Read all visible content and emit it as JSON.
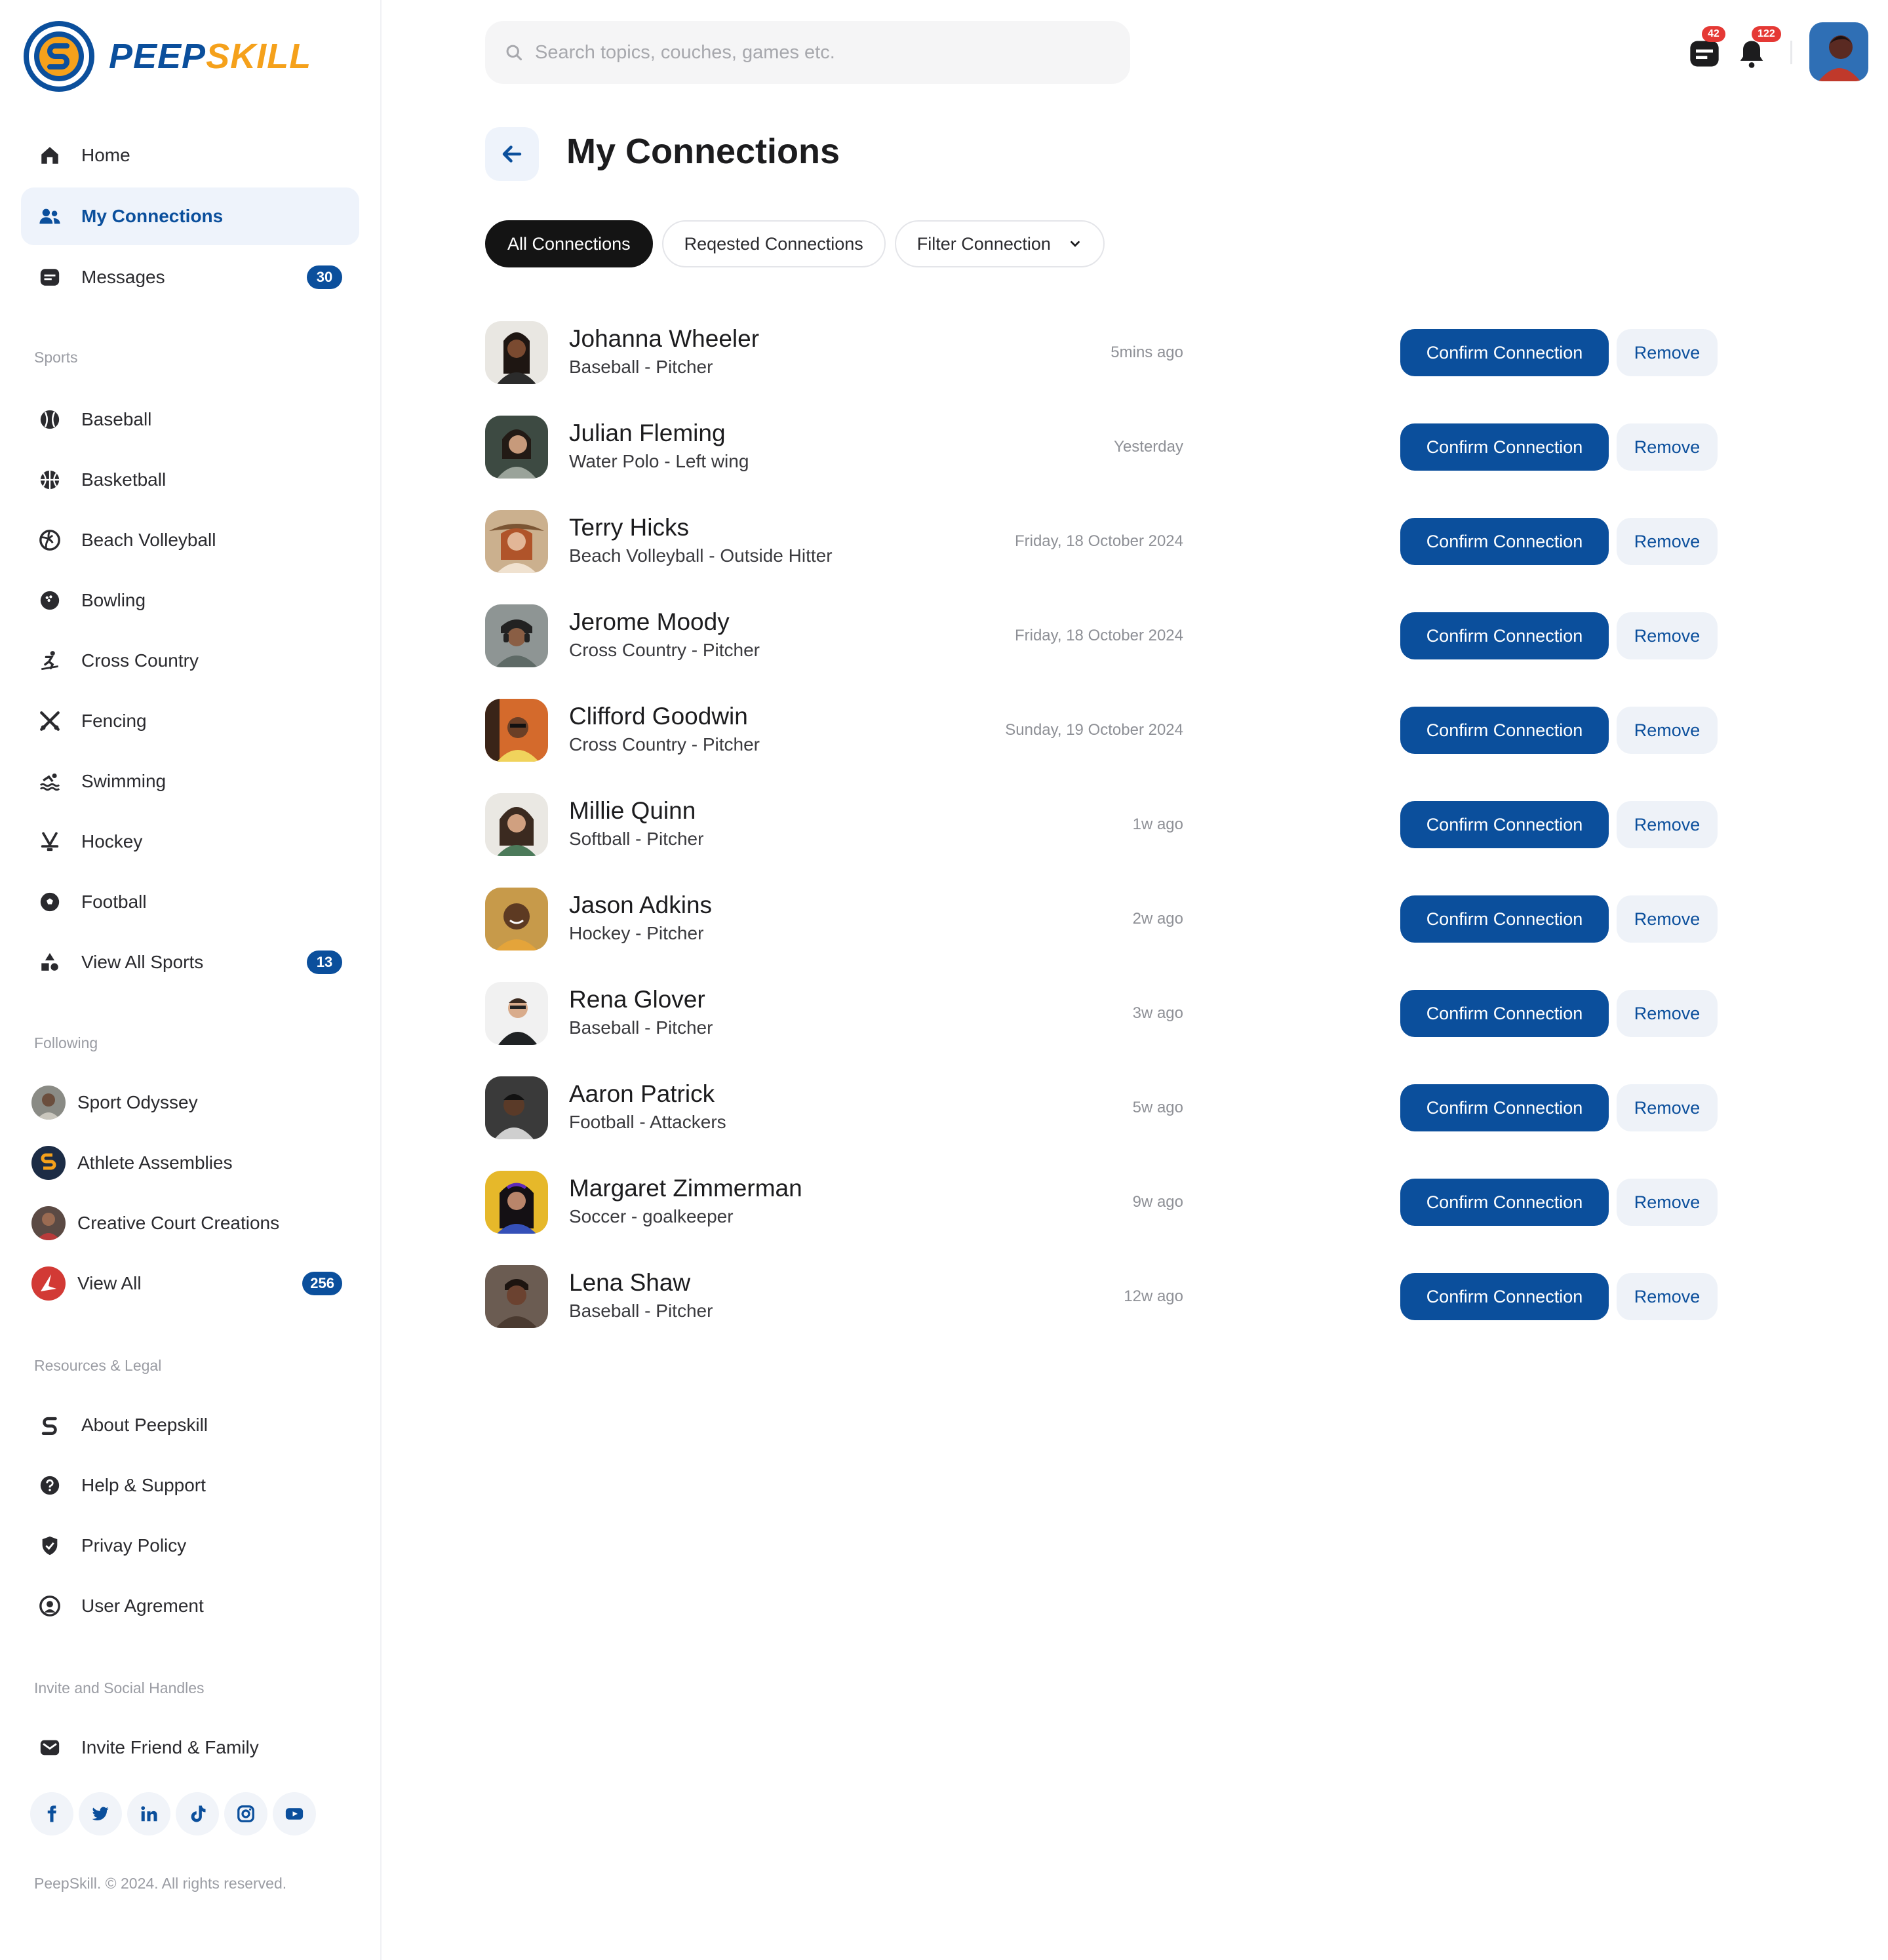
{
  "brand": {
    "name_part1": "PEEP",
    "name_part2": "SKILL",
    "primary_color": "#0b4f9c",
    "accent_color": "#f5a11b"
  },
  "nav": {
    "main": [
      {
        "label": "Home",
        "icon": "home-icon"
      },
      {
        "label": "My Connections",
        "icon": "connections-icon",
        "active": true
      },
      {
        "label": "Messages",
        "icon": "message-icon",
        "badge": "30"
      }
    ],
    "sports_label": "Sports",
    "sports": [
      {
        "label": "Baseball",
        "icon": "baseball-icon"
      },
      {
        "label": "Basketball",
        "icon": "basketball-icon"
      },
      {
        "label": "Beach Volleyball",
        "icon": "volleyball-icon"
      },
      {
        "label": "Bowling",
        "icon": "bowling-icon"
      },
      {
        "label": "Cross Country",
        "icon": "skiing-icon"
      },
      {
        "label": "Fencing",
        "icon": "fencing-icon"
      },
      {
        "label": "Swimming",
        "icon": "swimming-icon"
      },
      {
        "label": "Hockey",
        "icon": "hockey-icon"
      },
      {
        "label": "Football",
        "icon": "football-icon"
      },
      {
        "label": "View All Sports",
        "icon": "shapes-icon",
        "badge": "13"
      }
    ],
    "following_label": "Following",
    "following": [
      {
        "label": "Sport Odyssey"
      },
      {
        "label": "Athlete Assemblies"
      },
      {
        "label": "Creative Court Creations"
      },
      {
        "label": "View All",
        "badge": "256"
      }
    ],
    "resources_label": "Resources & Legal",
    "resources": [
      {
        "label": "About Peepskill",
        "icon": "peepskill-logo-icon"
      },
      {
        "label": "Help & Support",
        "icon": "help-icon"
      },
      {
        "label": "Privay Policy",
        "icon": "shield-icon"
      },
      {
        "label": "User Agrement",
        "icon": "user-circle-icon"
      }
    ],
    "invite_label": "Invite and Social Handles",
    "invite": {
      "label": "Invite Friend & Family",
      "icon": "mail-icon"
    },
    "socials": [
      "facebook-icon",
      "twitter-icon",
      "linkedin-icon",
      "tiktok-icon",
      "instagram-icon",
      "youtube-icon"
    ],
    "copyright": "PeepSkill. © 2024. All rights reserved."
  },
  "header": {
    "search_placeholder": "Search topics, couches, games etc.",
    "messages_badge": "42",
    "notifications_badge": "122"
  },
  "page": {
    "title": "My Connections",
    "tabs": [
      "All Connections",
      "Reqested Connections",
      "Filter Connection"
    ]
  },
  "connections": [
    {
      "name": "Johanna Wheeler",
      "sub": "Baseball - Pitcher",
      "time": "5mins ago"
    },
    {
      "name": "Julian Fleming",
      "sub": "Water Polo - Left wing",
      "time": "Yesterday"
    },
    {
      "name": "Terry Hicks",
      "sub": "Beach Volleyball - Outside Hitter",
      "time": "Friday, 18 October 2024"
    },
    {
      "name": "Jerome Moody",
      "sub": "Cross Country - Pitcher",
      "time": "Friday, 18 October 2024"
    },
    {
      "name": "Clifford Goodwin",
      "sub": "Cross Country - Pitcher",
      "time": "Sunday, 19 October 2024"
    },
    {
      "name": "Millie Quinn",
      "sub": "Softball - Pitcher",
      "time": "1w ago"
    },
    {
      "name": "Jason Adkins",
      "sub": "Hockey - Pitcher",
      "time": "2w ago"
    },
    {
      "name": "Rena Glover",
      "sub": "Baseball - Pitcher",
      "time": "3w ago"
    },
    {
      "name": "Aaron Patrick",
      "sub": "Football - Attackers",
      "time": "5w ago"
    },
    {
      "name": "Margaret Zimmerman",
      "sub": "Soccer - goalkeeper",
      "time": "9w ago"
    },
    {
      "name": "Lena Shaw",
      "sub": "Baseball - Pitcher",
      "time": "12w ago"
    }
  ],
  "actions": {
    "confirm": "Confirm Connection",
    "remove": "Remove"
  }
}
